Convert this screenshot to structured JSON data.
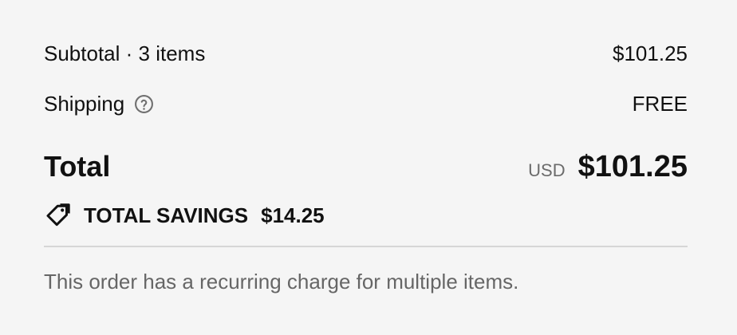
{
  "summary": {
    "subtotal_label": "Subtotal · 3 items",
    "subtotal_value": "$101.25",
    "shipping_label": "Shipping",
    "shipping_help_icon": "help-circle-icon",
    "shipping_value": "FREE",
    "total_label": "Total",
    "currency": "USD",
    "total_value": "$101.25",
    "savings_icon": "tag-icon",
    "savings_label": "TOTAL SAVINGS",
    "savings_value": "$14.25",
    "note": "This order has a recurring charge for multiple items."
  },
  "colors": {
    "background": "#f5f5f5",
    "text": "#111111",
    "muted_text": "#666666",
    "divider": "#d6d6d6"
  }
}
